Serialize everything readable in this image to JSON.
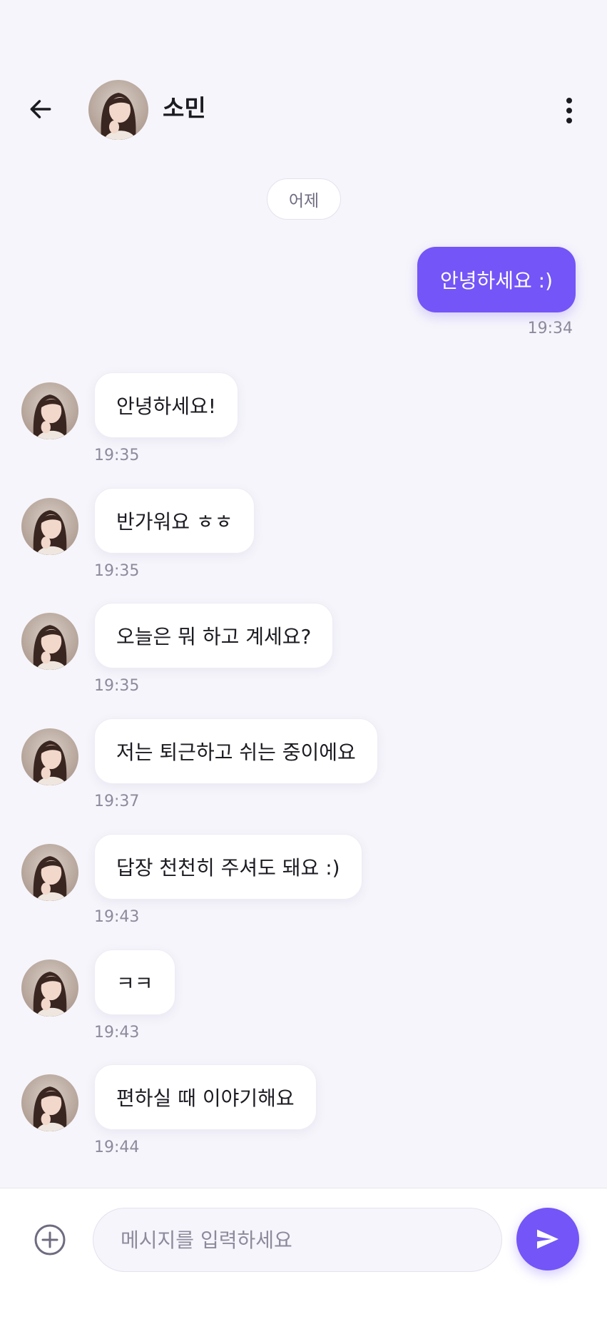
{
  "header": {
    "contact_name": "소민"
  },
  "date_divider": "어제",
  "sent_messages": [
    {
      "text": "안녕하세요 :)",
      "time": "19:34"
    }
  ],
  "received_messages": [
    {
      "text": "안녕하세요!",
      "time": "19:35"
    },
    {
      "text": "반가워요 ㅎㅎ",
      "time": "19:35"
    },
    {
      "text": "오늘은 뭐 하고 계세요?",
      "time": "19:35"
    },
    {
      "text": "저는 퇴근하고 쉬는 중이에요",
      "time": "19:37"
    },
    {
      "text": "답장 천천히 주셔도 돼요 :)",
      "time": "19:43"
    },
    {
      "text": "ㅋㅋ",
      "time": "19:43"
    },
    {
      "text": "편하실 때 이야기해요",
      "time": "19:44"
    }
  ],
  "composer": {
    "placeholder": "메시지를 입력하세요",
    "value": ""
  },
  "icons": {
    "back": "arrow-left-icon",
    "more": "more-vertical-icon",
    "attach": "plus-circle-icon",
    "send": "send-icon"
  },
  "colors": {
    "accent": "#7455f7",
    "background": "#f6f5fb",
    "bubble_received": "#ffffff",
    "time_text": "#8d8a9c"
  }
}
